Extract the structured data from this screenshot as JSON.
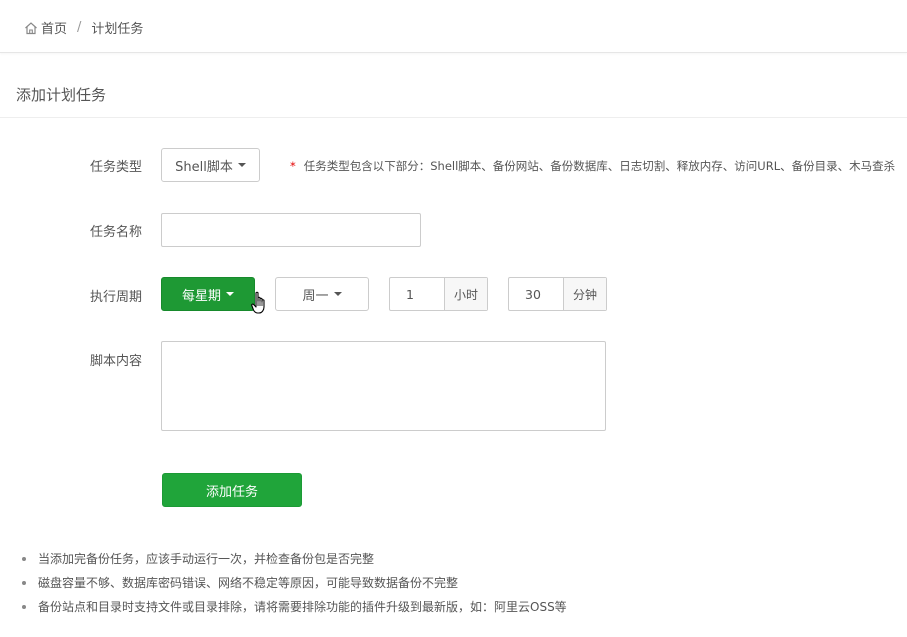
{
  "breadcrumb": {
    "home": "首页",
    "separator": "/",
    "current": "计划任务"
  },
  "section_title": "添加计划任务",
  "form": {
    "task_type": {
      "label": "任务类型",
      "value": "Shell脚本"
    },
    "hint": {
      "star": "*",
      "text": "任务类型包含以下部分：Shell脚本、备份网站、备份数据库、日志切割、释放内存、访问URL、备份目录、木马查杀"
    },
    "task_name": {
      "label": "任务名称",
      "value": ""
    },
    "period": {
      "label": "执行周期",
      "cycle": "每星期",
      "weekday": "周一",
      "hour": "1",
      "hour_unit": "小时",
      "minute": "30",
      "minute_unit": "分钟"
    },
    "script": {
      "label": "脚本内容",
      "value": ""
    },
    "submit": "添加任务"
  },
  "notes": [
    "当添加完备份任务，应该手动运行一次，并检查备份包是否完整",
    "磁盘容量不够、数据库密码错误、网络不稳定等原因，可能导致数据备份不完整",
    "备份站点和目录时支持文件或目录排除，请将需要排除功能的插件升级到最新版，如：阿里云OSS等"
  ],
  "colors": {
    "accent": "#1e9934",
    "required": "#e40000"
  },
  "icons": {
    "home": "home-icon",
    "pointer": "hand-pointer-icon"
  }
}
